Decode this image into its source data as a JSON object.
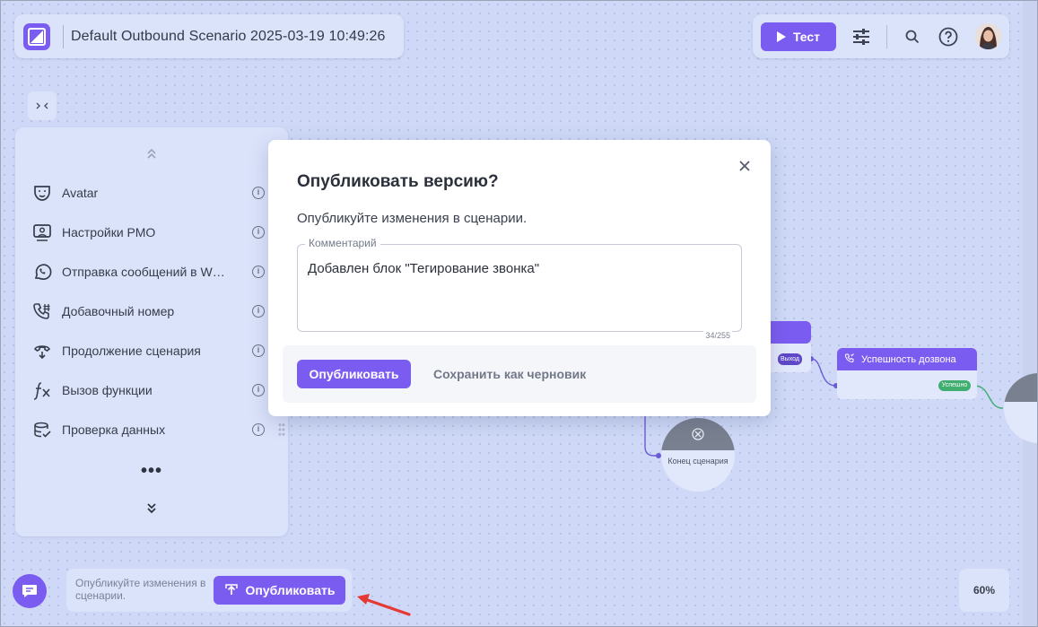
{
  "header": {
    "scenario_title": "Default Outbound Scenario 2025-03-19 10:49:26"
  },
  "toolbar": {
    "test_label": "Тест"
  },
  "sidebar": {
    "items": [
      {
        "label": "Avatar",
        "icon": "avatar-mask-icon"
      },
      {
        "label": "Настройки РМО",
        "icon": "operator-workstation-icon"
      },
      {
        "label": "Отправка сообщений в WhatsApp",
        "icon": "whatsapp-icon"
      },
      {
        "label": "Добавочный номер",
        "icon": "phone-extension-icon"
      },
      {
        "label": "Продолжение сценария",
        "icon": "scenario-continue-icon"
      },
      {
        "label": "Вызов функции",
        "icon": "function-fx-icon"
      },
      {
        "label": "Проверка данных",
        "icon": "data-check-icon"
      }
    ],
    "more_label": "•••"
  },
  "canvas": {
    "tag_exit": "Выход",
    "dial_node_title": "Успешность дозвона",
    "tag_success": "Успешно",
    "end_node_label": "Конец сценария"
  },
  "modal": {
    "title": "Опубликовать версию?",
    "description": "Опубликуйте изменения в сценарии.",
    "comment_label": "Комментарий",
    "comment_value": "Добавлен блок \"Тегирование звонка\"",
    "counter": "34/255",
    "publish_label": "Опубликовать",
    "draft_label": "Сохранить как черновик"
  },
  "publish_bar": {
    "hint": "Опубликуйте изменения в сценарии.",
    "publish_label": "Опубликовать"
  },
  "zoom": {
    "level": "60%"
  },
  "colors": {
    "accent": "#7b5cf0",
    "canvas_bg": "#cfd9f7",
    "panel_bg": "#dbe3fb",
    "success": "#3fae6e",
    "annotation_arrow": "#e53935"
  }
}
